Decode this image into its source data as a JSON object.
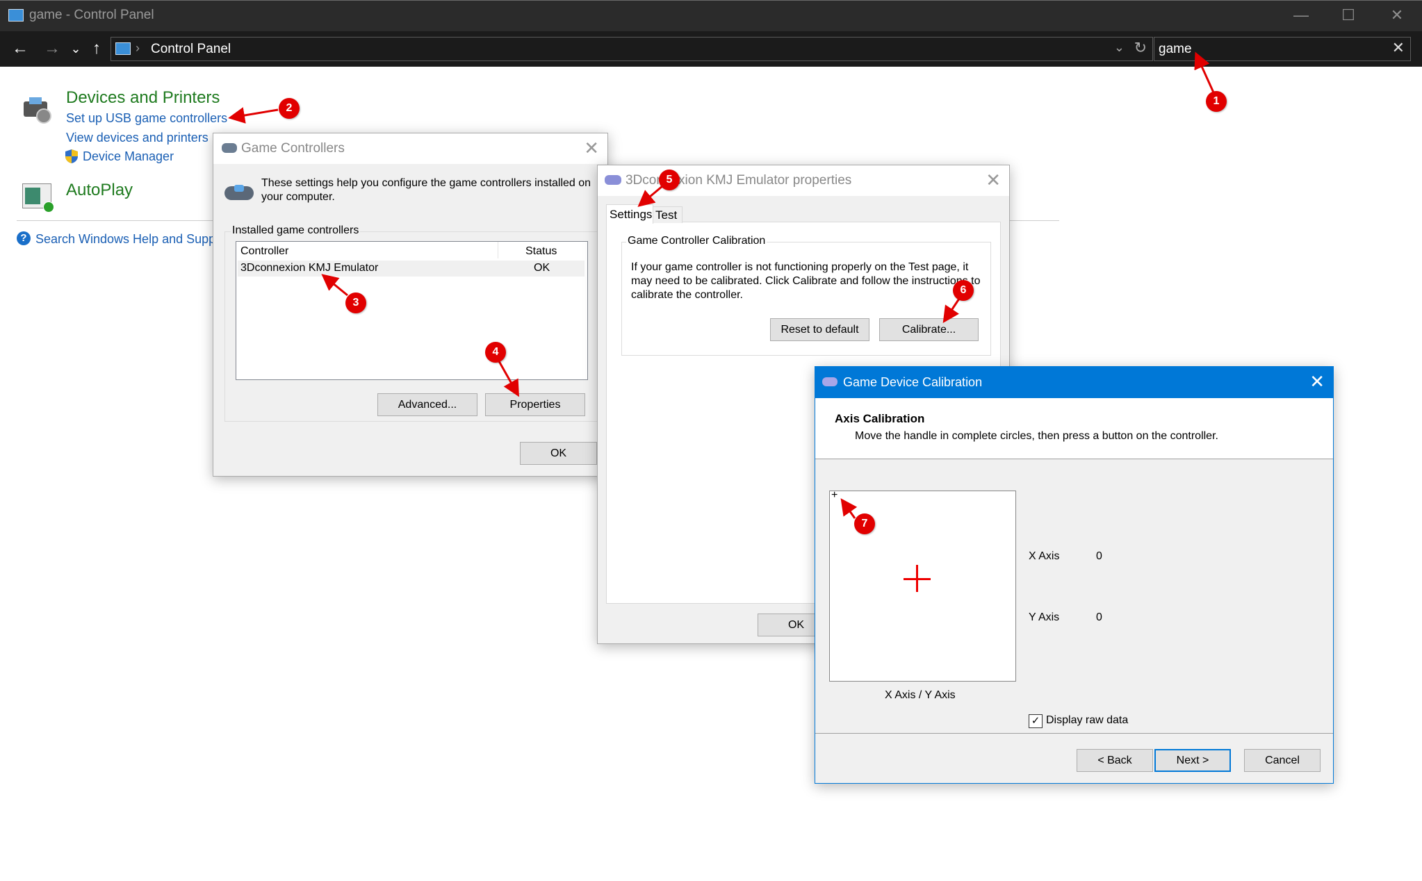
{
  "window": {
    "title": "game - Control Panel",
    "controls": {
      "minimize": "—",
      "maximize": "☐",
      "close": "✕"
    }
  },
  "nav": {
    "back": "←",
    "forward": "→",
    "recent": "⌄",
    "up": "↑",
    "breadcrumb_sep": "›",
    "breadcrumb": "Control Panel",
    "dropdown": "⌄",
    "refresh": "↻"
  },
  "search": {
    "value": "game",
    "clear": "✕"
  },
  "results": {
    "devices": {
      "heading": "Devices and Printers",
      "links": [
        "Set up USB game controllers",
        "View devices and printers",
        "Device Manager"
      ]
    },
    "autoplay": {
      "heading": "AutoPlay"
    },
    "help_link": "Search Windows Help and Supp"
  },
  "game_controllers": {
    "title": "Game Controllers",
    "close": "✕",
    "intro": "These settings help you configure the game controllers installed on your computer.",
    "group_label": "Installed game controllers",
    "columns": [
      "Controller",
      "Status"
    ],
    "rows": [
      {
        "controller": "3Dconnexion KMJ Emulator",
        "status": "OK"
      }
    ],
    "buttons": {
      "advanced": "Advanced...",
      "properties": "Properties",
      "ok": "OK"
    }
  },
  "properties": {
    "title": "3Dconnexion KMJ Emulator properties",
    "close": "✕",
    "tabs": [
      "Settings",
      "Test"
    ],
    "group_label": "Game Controller Calibration",
    "description": "If your game controller is not functioning properly on the Test page, it may need to be calibrated.  Click Calibrate and follow the instructions to calibrate the controller.",
    "buttons": {
      "reset": "Reset to default",
      "calibrate": "Calibrate...",
      "ok": "OK"
    }
  },
  "calibration": {
    "title": "Game Device Calibration",
    "close": "✕",
    "heading": "Axis Calibration",
    "instruction": "Move the handle in complete circles, then press a button on the controller.",
    "box_label": "X Axis / Y Axis",
    "axes": [
      {
        "label": "X Axis",
        "value": "0"
      },
      {
        "label": "Y Axis",
        "value": "0"
      }
    ],
    "raw_data": {
      "label": "Display raw data",
      "checked": true
    },
    "buttons": {
      "back": "< Back",
      "next": "Next >",
      "cancel": "Cancel"
    },
    "accent": "#0078d7"
  },
  "annotations": [
    "1",
    "2",
    "3",
    "4",
    "5",
    "6",
    "7"
  ],
  "colors": {
    "annotation": "#e10000",
    "link": "#1a5fb4",
    "heading": "#1e7a1e",
    "titlebar": "#2b2b2b",
    "navbar": "#1b1b1b"
  }
}
